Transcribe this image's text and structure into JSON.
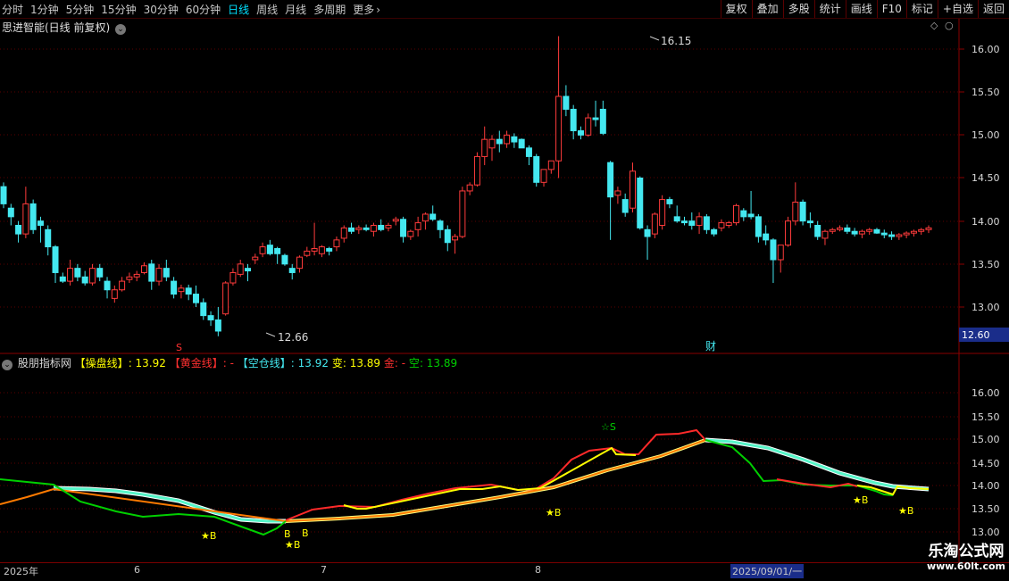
{
  "toolbar": {
    "periods": [
      "分时",
      "1分钟",
      "5分钟",
      "15分钟",
      "30分钟",
      "60分钟",
      "日线",
      "周线",
      "月线",
      "多周期",
      "更多"
    ],
    "active_period": "日线",
    "more_icon": "chevron-right-icon",
    "buttons": [
      "复权",
      "叠加",
      "多股",
      "统计",
      "画线",
      "F10",
      "标记",
      "+自选",
      "返回"
    ]
  },
  "main_chart": {
    "title": "思进智能(日线 前复权)",
    "title_icon": "chevron-down-icon",
    "high_label": "16.15",
    "low_label": "12.66",
    "marker_s": "S",
    "marker_cai": "财",
    "current_price_badge": "12.60",
    "price_ticks": [
      "16.00",
      "15.50",
      "15.00",
      "14.50",
      "14.00",
      "13.50",
      "13.00"
    ]
  },
  "indicator": {
    "name": "股朋指标网",
    "caopan_label": "【操盘线】",
    "caopan_value": ": 13.92",
    "huangjin_label": "【黄金线】",
    "huangjin_value": ": -",
    "kongcang_label": "【空仓线】",
    "kongcang_value": ": 13.92",
    "bian_label": "变",
    "bian_value": ": 13.89",
    "jin_label": "金",
    "jin_value": ": -",
    "kong_label": "空",
    "kong_value": ": 13.89",
    "signal_s": "☆S",
    "signal_b_star": "★B",
    "signal_b": "B",
    "price_ticks": [
      "16.00",
      "15.50",
      "15.00",
      "14.50",
      "14.00",
      "13.50",
      "13.00"
    ]
  },
  "date_axis": {
    "labels": [
      "2025年",
      "6",
      "7",
      "8"
    ],
    "cursor_date": "2025/09/01/一"
  },
  "watermark": {
    "line1": "乐淘公式网",
    "line2": "www.60lt.com"
  },
  "colors": {
    "up": "#ff3b3b",
    "down": "#44e8f0",
    "yellow": "#ffff00",
    "green": "#00d000",
    "cyan_line": "#55f5c8",
    "gold_line": "#ff9a00",
    "frame": "#8a0000"
  },
  "chart_data": {
    "type": "candlestick",
    "x": [
      "d1",
      "d2",
      "d3",
      "d4",
      "d5",
      "d6",
      "d7",
      "d8",
      "d9",
      "d10",
      "d11",
      "d12",
      "d13",
      "d14",
      "d15",
      "d16",
      "d17",
      "d18",
      "d19",
      "d20",
      "d21",
      "d22",
      "d23",
      "d24",
      "d25",
      "d26",
      "d27",
      "d28",
      "d29",
      "d30",
      "d31",
      "d32",
      "d33",
      "d34",
      "d35",
      "d36",
      "d37",
      "d38",
      "d39",
      "d40",
      "d41",
      "d42",
      "d43",
      "d44",
      "d45",
      "d46",
      "d47",
      "d48",
      "d49",
      "d50",
      "d51",
      "d52",
      "d53",
      "d54",
      "d55",
      "d56",
      "d57",
      "d58",
      "d59",
      "d60",
      "d61",
      "d62",
      "d63",
      "d64",
      "d65",
      "d66",
      "d67",
      "d68",
      "d69",
      "d70",
      "d71",
      "d72",
      "d73",
      "d74",
      "d75",
      "d76",
      "d77",
      "d78",
      "d79",
      "d80",
      "d81",
      "d82",
      "d83",
      "d84",
      "d85",
      "d86",
      "d87",
      "d88",
      "d89",
      "d90",
      "d91",
      "d92",
      "d93",
      "d94",
      "d95",
      "d96",
      "d97",
      "d98",
      "d99",
      "d100",
      "d101",
      "d102",
      "d103",
      "d104",
      "d105",
      "d106",
      "d107",
      "d108",
      "d109",
      "d110",
      "d111",
      "d112",
      "d113",
      "d114",
      "d115",
      "d116",
      "d117",
      "d118",
      "d119",
      "d120",
      "d121",
      "d122",
      "d123",
      "d124",
      "d125",
      "d126",
      "d127",
      "d128",
      "d129",
      "d130",
      "d131"
    ],
    "ohlc": [
      [
        14.4,
        14.45,
        14.15,
        14.2
      ],
      [
        14.15,
        14.2,
        13.95,
        14.05
      ],
      [
        13.95,
        14.0,
        13.75,
        13.85
      ],
      [
        13.85,
        14.4,
        13.8,
        14.2
      ],
      [
        14.2,
        14.25,
        13.85,
        13.9
      ],
      [
        14.0,
        14.05,
        13.75,
        13.95
      ],
      [
        13.9,
        13.95,
        13.6,
        13.7
      ],
      [
        13.7,
        13.72,
        13.28,
        13.4
      ],
      [
        13.35,
        13.4,
        13.28,
        13.3
      ],
      [
        13.3,
        13.55,
        13.25,
        13.45
      ],
      [
        13.45,
        13.5,
        13.3,
        13.35
      ],
      [
        13.35,
        13.42,
        13.25,
        13.28
      ],
      [
        13.28,
        13.5,
        13.25,
        13.45
      ],
      [
        13.45,
        13.5,
        13.3,
        13.35
      ],
      [
        13.3,
        13.35,
        13.1,
        13.2
      ],
      [
        13.1,
        13.25,
        13.05,
        13.2
      ],
      [
        13.2,
        13.35,
        13.18,
        13.3
      ],
      [
        13.32,
        13.4,
        13.28,
        13.35
      ],
      [
        13.35,
        13.42,
        13.3,
        13.38
      ],
      [
        13.4,
        13.52,
        13.38,
        13.48
      ],
      [
        13.5,
        13.55,
        13.2,
        13.3
      ],
      [
        13.3,
        13.5,
        13.25,
        13.45
      ],
      [
        13.45,
        13.55,
        13.3,
        13.35
      ],
      [
        13.3,
        13.35,
        13.1,
        13.15
      ],
      [
        13.18,
        13.26,
        13.1,
        13.22
      ],
      [
        13.22,
        13.26,
        13.08,
        13.15
      ],
      [
        13.15,
        13.25,
        13.0,
        13.05
      ],
      [
        13.05,
        13.1,
        12.85,
        12.9
      ],
      [
        12.9,
        12.95,
        12.78,
        12.85
      ],
      [
        12.85,
        13.0,
        12.66,
        12.72
      ],
      [
        12.92,
        13.3,
        12.9,
        13.28
      ],
      [
        13.28,
        13.45,
        13.25,
        13.4
      ],
      [
        13.38,
        13.55,
        13.35,
        13.5
      ],
      [
        13.45,
        13.5,
        13.3,
        13.42
      ],
      [
        13.55,
        13.62,
        13.5,
        13.58
      ],
      [
        13.62,
        13.75,
        13.58,
        13.7
      ],
      [
        13.72,
        13.78,
        13.6,
        13.62
      ],
      [
        13.68,
        13.7,
        13.5,
        13.62
      ],
      [
        13.6,
        13.62,
        13.48,
        13.5
      ],
      [
        13.45,
        13.5,
        13.32,
        13.4
      ],
      [
        13.45,
        13.6,
        13.4,
        13.58
      ],
      [
        13.6,
        13.7,
        13.58,
        13.65
      ],
      [
        13.65,
        13.98,
        13.6,
        13.68
      ],
      [
        13.62,
        13.72,
        13.58,
        13.7
      ],
      [
        13.68,
        13.7,
        13.6,
        13.65
      ],
      [
        13.7,
        13.82,
        13.65,
        13.78
      ],
      [
        13.8,
        13.95,
        13.75,
        13.92
      ],
      [
        13.92,
        13.98,
        13.85,
        13.88
      ],
      [
        13.9,
        13.95,
        13.85,
        13.92
      ],
      [
        13.92,
        13.96,
        13.88,
        13.9
      ],
      [
        13.88,
        13.98,
        13.82,
        13.95
      ],
      [
        13.95,
        14.02,
        13.88,
        13.9
      ],
      [
        13.92,
        13.98,
        13.88,
        13.95
      ],
      [
        14.0,
        14.05,
        13.95,
        14.02
      ],
      [
        14.02,
        14.05,
        13.75,
        13.82
      ],
      [
        13.82,
        13.9,
        13.78,
        13.88
      ],
      [
        13.9,
        14.05,
        13.82,
        13.98
      ],
      [
        14.0,
        14.1,
        13.9,
        14.08
      ],
      [
        14.08,
        14.18,
        14.0,
        14.02
      ],
      [
        14.0,
        14.02,
        13.8,
        13.9
      ],
      [
        13.9,
        13.95,
        13.65,
        13.75
      ],
      [
        13.78,
        13.85,
        13.62,
        13.82
      ],
      [
        13.82,
        14.4,
        13.8,
        14.35
      ],
      [
        14.35,
        14.45,
        14.3,
        14.42
      ],
      [
        14.42,
        14.8,
        14.4,
        14.75
      ],
      [
        14.75,
        15.1,
        14.65,
        14.95
      ],
      [
        14.85,
        15.0,
        14.7,
        14.95
      ],
      [
        14.95,
        15.05,
        14.8,
        14.9
      ],
      [
        14.9,
        15.05,
        14.85,
        15.0
      ],
      [
        14.98,
        15.02,
        14.85,
        14.92
      ],
      [
        14.95,
        14.96,
        14.85,
        14.85
      ],
      [
        14.85,
        14.88,
        14.65,
        14.75
      ],
      [
        14.75,
        14.78,
        14.4,
        14.45
      ],
      [
        14.45,
        14.55,
        14.4,
        14.6
      ],
      [
        14.6,
        14.7,
        14.55,
        14.7
      ],
      [
        14.7,
        16.15,
        14.5,
        15.45
      ],
      [
        15.45,
        15.58,
        15.22,
        15.3
      ],
      [
        15.3,
        15.35,
        14.95,
        15.05
      ],
      [
        15.05,
        15.1,
        14.95,
        15.0
      ],
      [
        15.0,
        15.25,
        14.98,
        15.2
      ],
      [
        15.2,
        15.4,
        15.1,
        15.18
      ],
      [
        15.3,
        15.4,
        15.0,
        15.02
      ],
      [
        14.68,
        14.7,
        13.78,
        14.28
      ],
      [
        14.3,
        14.4,
        14.2,
        14.35
      ],
      [
        14.25,
        14.32,
        14.05,
        14.1
      ],
      [
        14.15,
        14.68,
        14.1,
        14.58
      ],
      [
        14.5,
        14.52,
        13.9,
        13.92
      ],
      [
        13.9,
        13.95,
        13.55,
        13.82
      ],
      [
        13.85,
        14.1,
        13.8,
        14.08
      ],
      [
        13.95,
        14.3,
        13.9,
        14.25
      ],
      [
        14.25,
        14.28,
        14.15,
        14.2
      ],
      [
        14.05,
        14.18,
        13.98,
        14.0
      ],
      [
        14.0,
        14.05,
        13.95,
        13.98
      ],
      [
        14.0,
        14.1,
        13.9,
        13.95
      ],
      [
        13.95,
        14.1,
        13.85,
        14.05
      ],
      [
        14.05,
        14.08,
        13.85,
        13.9
      ],
      [
        13.9,
        13.92,
        13.82,
        13.85
      ],
      [
        13.92,
        14.02,
        13.88,
        13.98
      ],
      [
        13.95,
        14.0,
        13.92,
        13.98
      ],
      [
        13.98,
        14.2,
        13.95,
        14.18
      ],
      [
        14.12,
        14.15,
        14.0,
        14.05
      ],
      [
        14.08,
        14.35,
        14.02,
        14.05
      ],
      [
        14.05,
        14.08,
        13.75,
        13.82
      ],
      [
        13.85,
        13.95,
        13.72,
        13.78
      ],
      [
        13.78,
        13.8,
        13.28,
        13.55
      ],
      [
        13.55,
        13.68,
        13.4,
        13.72
      ],
      [
        13.72,
        14.05,
        13.7,
        14.0
      ],
      [
        14.0,
        14.45,
        13.95,
        14.22
      ],
      [
        14.22,
        14.25,
        13.95,
        14.0
      ],
      [
        14.0,
        14.1,
        13.92,
        13.98
      ],
      [
        13.95,
        14.0,
        13.78,
        13.82
      ],
      [
        13.8,
        13.9,
        13.72,
        13.88
      ],
      [
        13.88,
        13.92,
        13.85,
        13.9
      ],
      [
        13.9,
        13.95,
        13.88,
        13.92
      ],
      [
        13.92,
        13.96,
        13.85,
        13.88
      ],
      [
        13.88,
        13.92,
        13.82,
        13.85
      ],
      [
        13.85,
        13.9,
        13.8,
        13.88
      ],
      [
        13.88,
        13.92,
        13.84,
        13.9
      ],
      [
        13.9,
        13.92,
        13.85,
        13.86
      ],
      [
        13.86,
        13.9,
        13.8,
        13.84
      ],
      [
        13.84,
        13.88,
        13.78,
        13.82
      ],
      [
        13.82,
        13.86,
        13.78,
        13.84
      ],
      [
        13.84,
        13.88,
        13.8,
        13.86
      ],
      [
        13.86,
        13.9,
        13.82,
        13.88
      ],
      [
        13.88,
        13.92,
        13.84,
        13.9
      ],
      [
        13.9,
        13.95,
        13.86,
        13.92
      ]
    ],
    "ylim": [
      12.6,
      16.3
    ]
  }
}
